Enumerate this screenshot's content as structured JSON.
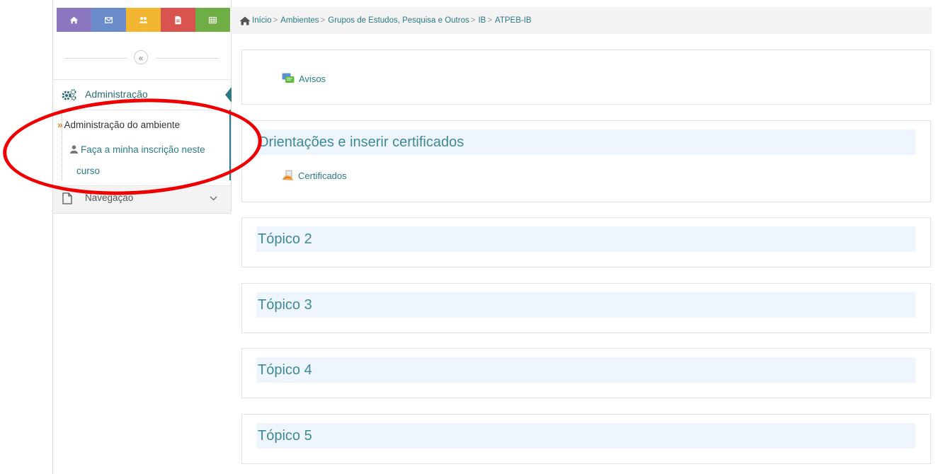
{
  "quick_bar": {
    "items": [
      {
        "icon": "home-icon",
        "color": "#8b77c0"
      },
      {
        "icon": "mail-icon",
        "color": "#6a8ccb"
      },
      {
        "icon": "users-icon",
        "color": "#f2b632"
      },
      {
        "icon": "file-icon",
        "color": "#d9534f"
      },
      {
        "icon": "table-icon",
        "color": "#6fae45"
      }
    ]
  },
  "sidebar": {
    "collapse_glyph": "«",
    "administration": {
      "title": "Administração",
      "items": [
        {
          "label": "Administração do ambiente"
        },
        {
          "label_line1": "Faça a minha inscrição neste",
          "label_line2": "curso"
        }
      ]
    },
    "navigation": {
      "title": "Navegação"
    }
  },
  "breadcrumb": {
    "items": [
      "Início",
      "Ambientes",
      "Grupos de Estudos, Pesquisa e Outros",
      "IB",
      "ATPEB-IB"
    ],
    "separator": ">"
  },
  "sections": [
    {
      "activity": "Avisos",
      "activity_icon": "forum-icon"
    },
    {
      "title": "Orientações e inserir certificados",
      "activity": "Certificados",
      "activity_icon": "certificate-icon"
    },
    {
      "title": "Tópico 2"
    },
    {
      "title": "Tópico 3"
    },
    {
      "title": "Tópico 4"
    },
    {
      "title": "Tópico 5"
    }
  ],
  "colors": {
    "accent": "#2a7a85",
    "section_title": "#3d8a96",
    "annotation": "#ee0000"
  }
}
